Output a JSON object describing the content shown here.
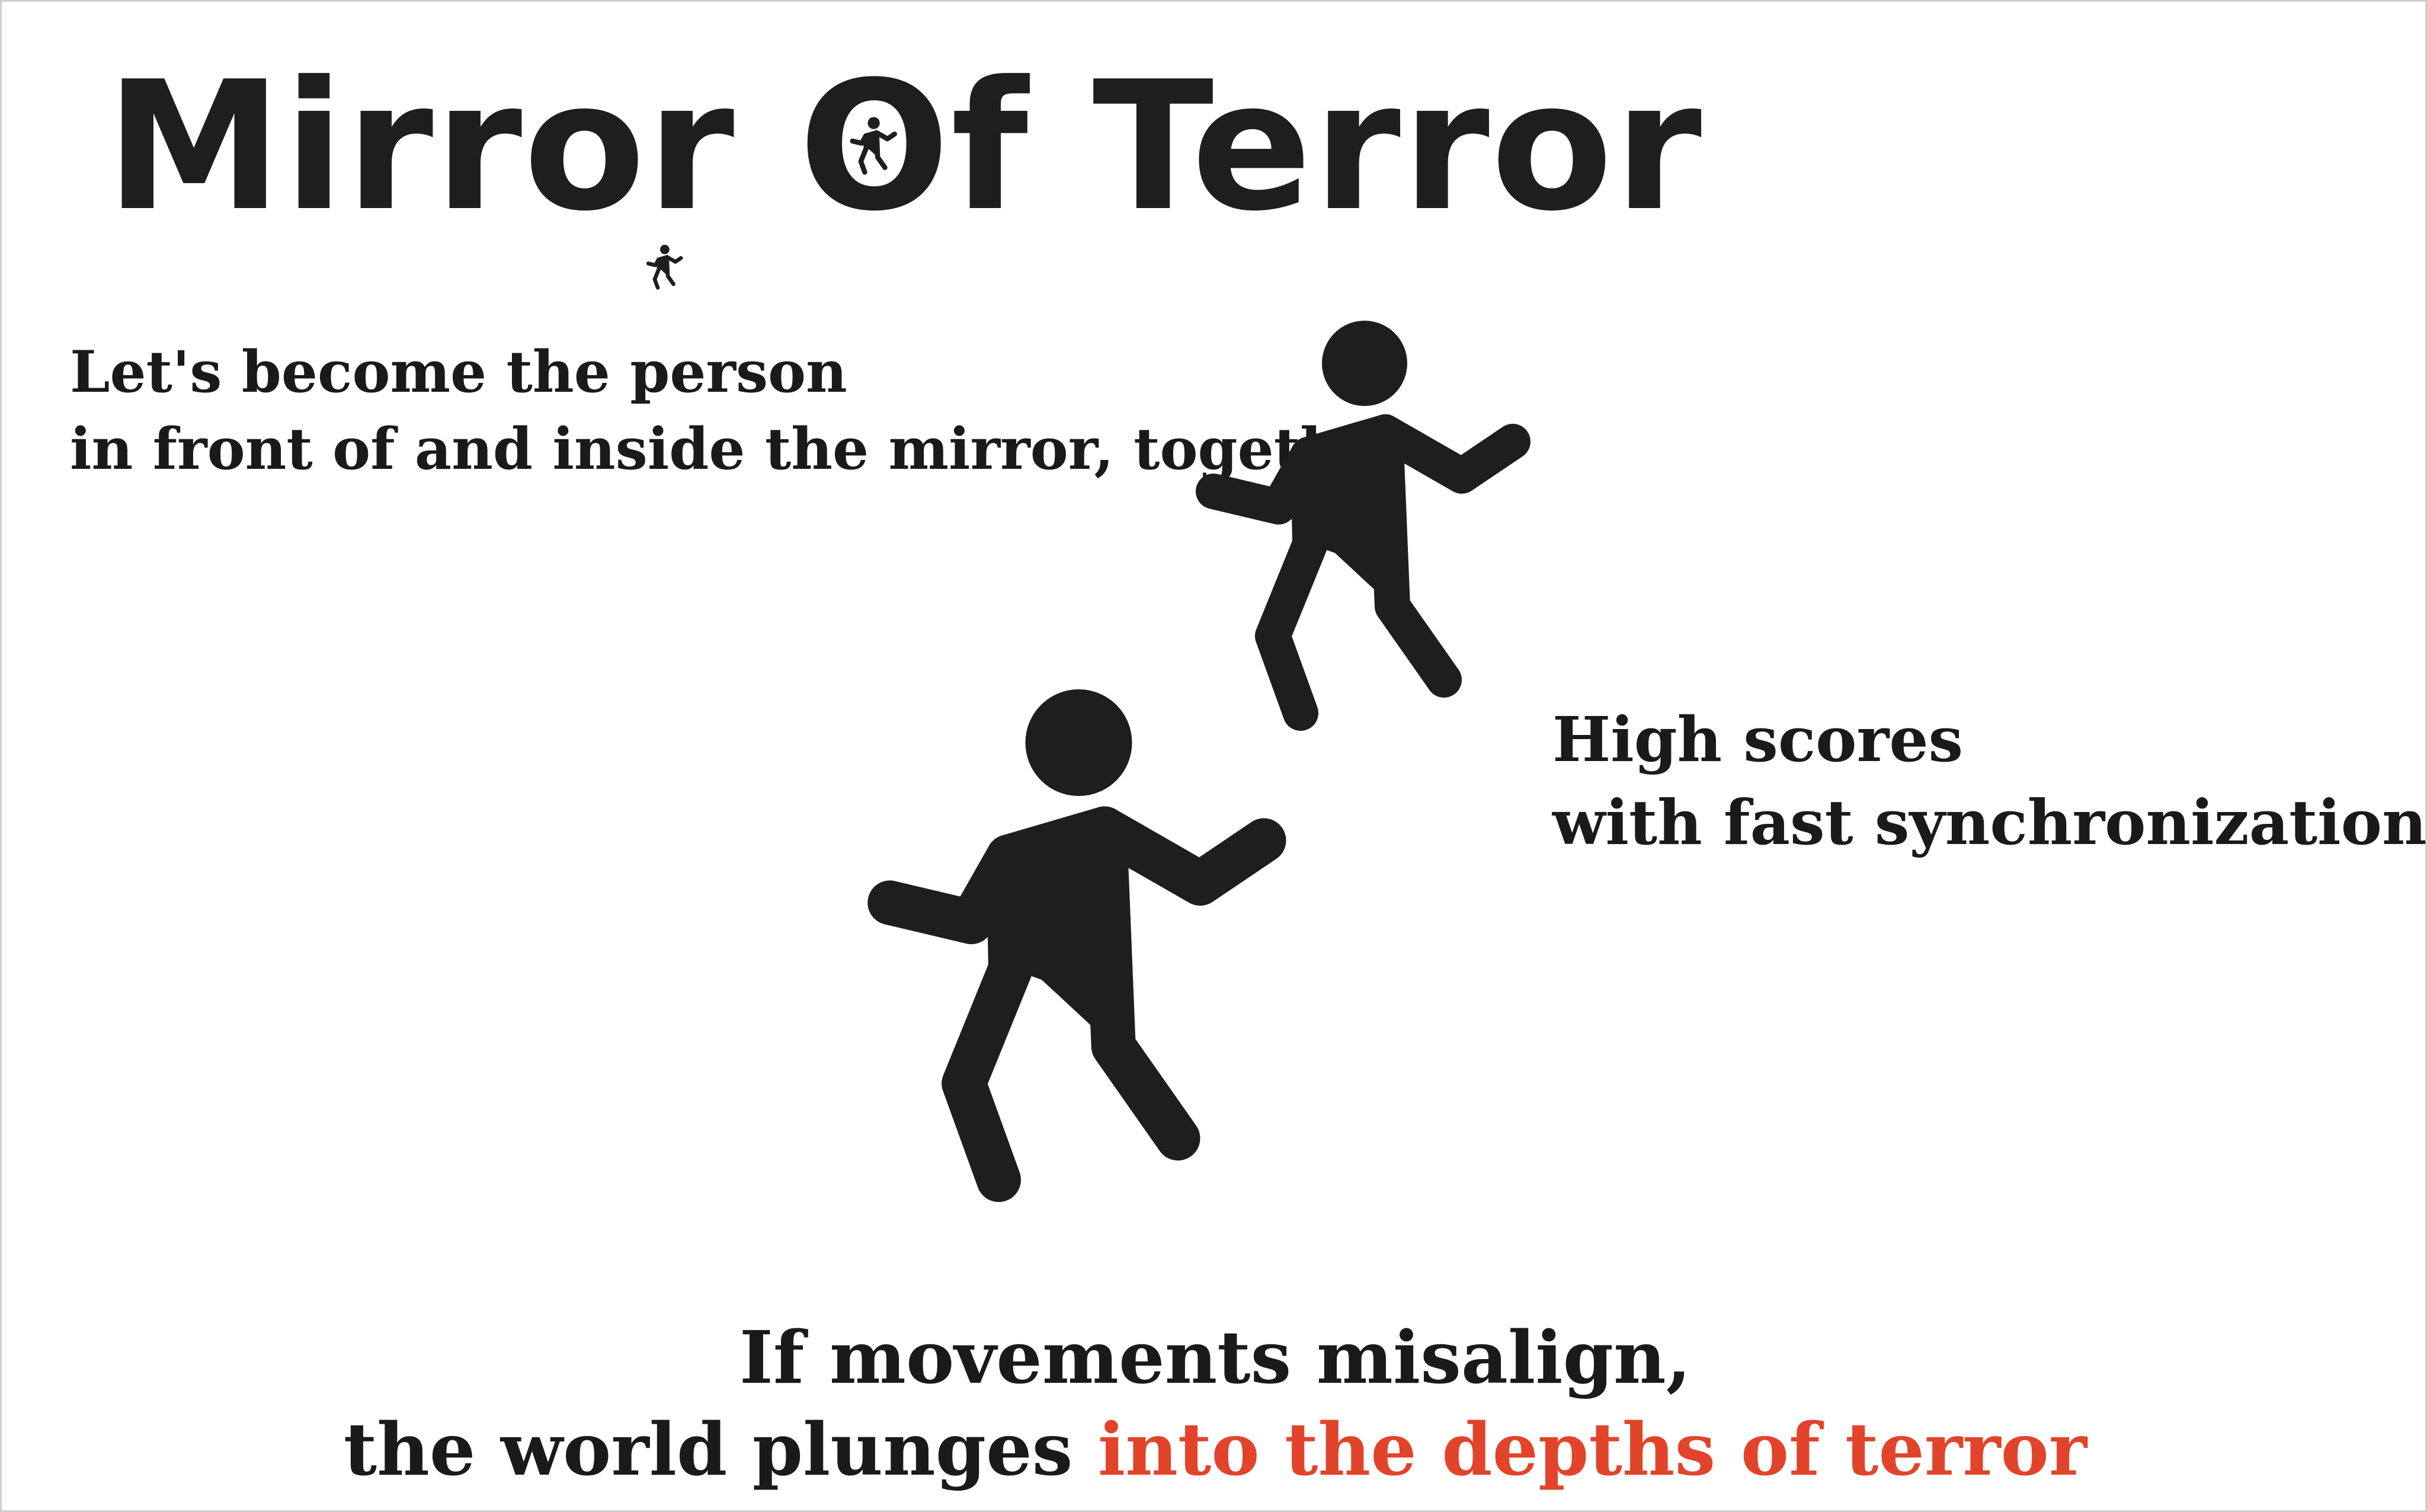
{
  "title": {
    "part_before": "Mirror ",
    "o_letter": "O",
    "part_after": "f Terror"
  },
  "tagline": {
    "line1": "Let's become the person",
    "line2": "in front of and inside the mirror, together"
  },
  "scoring": {
    "line1": "High scores",
    "line2": "with fast synchronization"
  },
  "warning": {
    "line1": "If movements misalign,",
    "line2_plain": "the world plunges ",
    "line2_accent": "into the depths of terror"
  },
  "colors": {
    "ink": "#1e1e1e",
    "accent": "#e1442b",
    "background": "#ffffff"
  },
  "icons": {
    "figures": "walking-person-icon"
  }
}
